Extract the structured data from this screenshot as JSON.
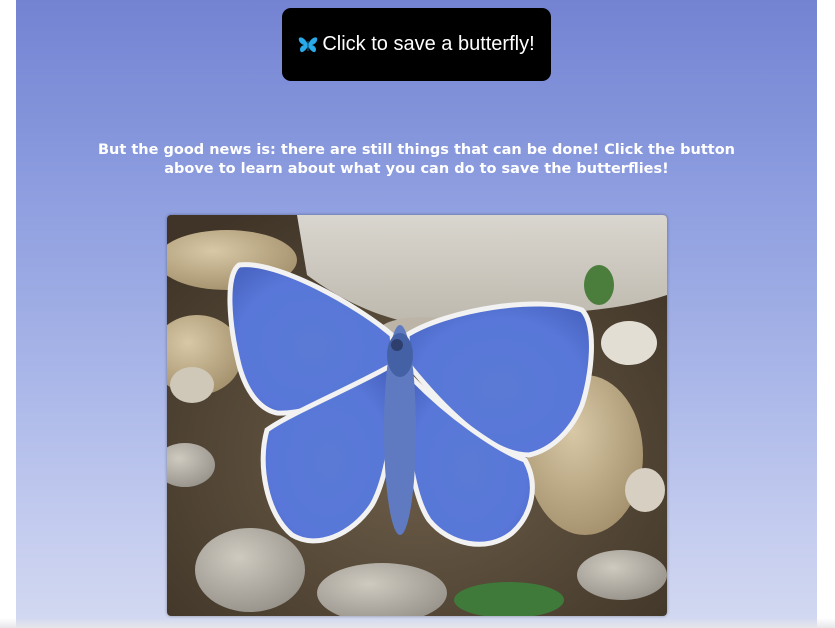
{
  "button": {
    "label": "Click to save a butterfly!",
    "icon": "butterfly-icon",
    "icon_color": "#29a9e8",
    "background": "#000000"
  },
  "message": {
    "text": "But the good news is: there are still things that can be done! Click the button above to learn about what you can do to save the butterflies!"
  },
  "photo": {
    "subject": "blue-butterfly-photo"
  },
  "colors": {
    "page_gradient_top": "#7383d2",
    "page_gradient_bottom": "#d3d9f1",
    "text": "#ffffff"
  }
}
